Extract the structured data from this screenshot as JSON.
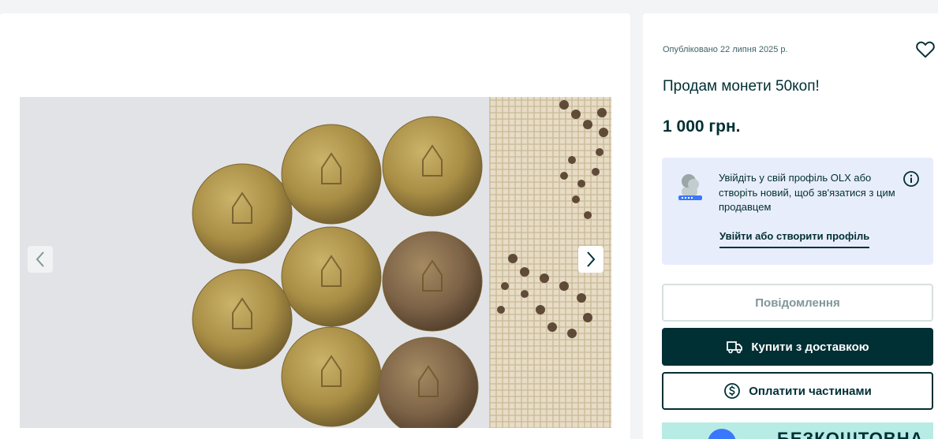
{
  "listing": {
    "posted_date": "Опубліковано 22 липня 2025 р.",
    "title": "Продам монети 50коп!",
    "price": "1 000 грн."
  },
  "login_prompt": {
    "text": "Увійдіть у свій профіль OLX або створіть новий, щоб зв'язатися з цим продавцем",
    "link_label": "Увійти або створити профіль"
  },
  "actions": {
    "message_label": "Повідомлення",
    "buy_label": "Купити з доставкою",
    "pay_parts_label": "Оплатити частинами"
  },
  "promo": {
    "text": "БЕЗКОШТОВНА"
  },
  "icons": {
    "heart": "heart-icon",
    "info": "info-icon",
    "truck": "truck-icon",
    "dollar": "dollar-circle-icon",
    "prev": "chevron-left-icon",
    "next": "chevron-right-icon"
  },
  "colors": {
    "primary": "#002f34",
    "login_bg": "#e8edfb",
    "promo_bg": "#b7ece5",
    "page_bg": "#f2f4f5"
  }
}
